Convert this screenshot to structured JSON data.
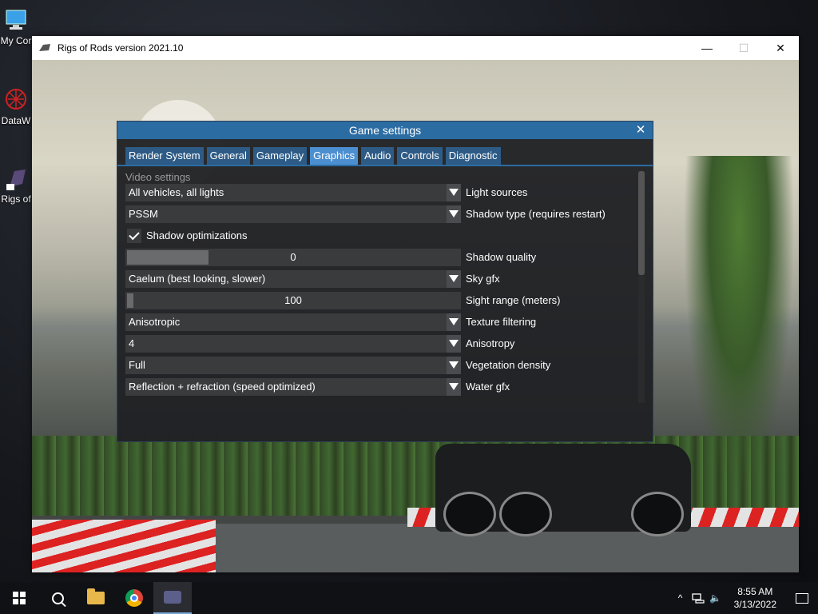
{
  "desktop": {
    "icons": [
      {
        "label": "My Cor"
      },
      {
        "label": "DataW"
      },
      {
        "label": "Rigs of"
      }
    ]
  },
  "window": {
    "title": "Rigs of Rods version 2021.10",
    "minimize": "—",
    "maximize": "☐",
    "close": "✕"
  },
  "dialog": {
    "title": "Game settings",
    "close": "✕",
    "tabs": [
      "Render System",
      "General",
      "Gameplay",
      "Graphics",
      "Audio",
      "Controls",
      "Diagnostic"
    ],
    "active_tab": "Graphics",
    "section": "Video settings",
    "settings": {
      "light_sources": {
        "value": "All vehicles, all lights",
        "label": "Light sources"
      },
      "shadow_type": {
        "value": "PSSM",
        "label": "Shadow type (requires restart)"
      },
      "shadow_optimizations": {
        "label": "Shadow optimizations",
        "checked": true
      },
      "shadow_quality": {
        "value": "0",
        "label": "Shadow quality"
      },
      "sky_gfx": {
        "value": "Caelum (best looking, slower)",
        "label": "Sky gfx"
      },
      "sight_range": {
        "value": "100",
        "label": "Sight range (meters)"
      },
      "texture_filtering": {
        "value": "Anisotropic",
        "label": "Texture filtering"
      },
      "anisotropy": {
        "value": "4",
        "label": "Anisotropy"
      },
      "vegetation_density": {
        "value": "Full",
        "label": "Vegetation density"
      },
      "water_gfx": {
        "value": "Reflection + refraction (speed optimized)",
        "label": "Water gfx"
      }
    }
  },
  "taskbar": {
    "time": "8:55 AM",
    "date": "3/13/2022",
    "tray_chevron": "^",
    "volume_icon": "🔈"
  },
  "colors": {
    "dialog_accent": "#2b6ca3",
    "tab": "#2d5b86",
    "tab_active": "#4c8fd1"
  }
}
